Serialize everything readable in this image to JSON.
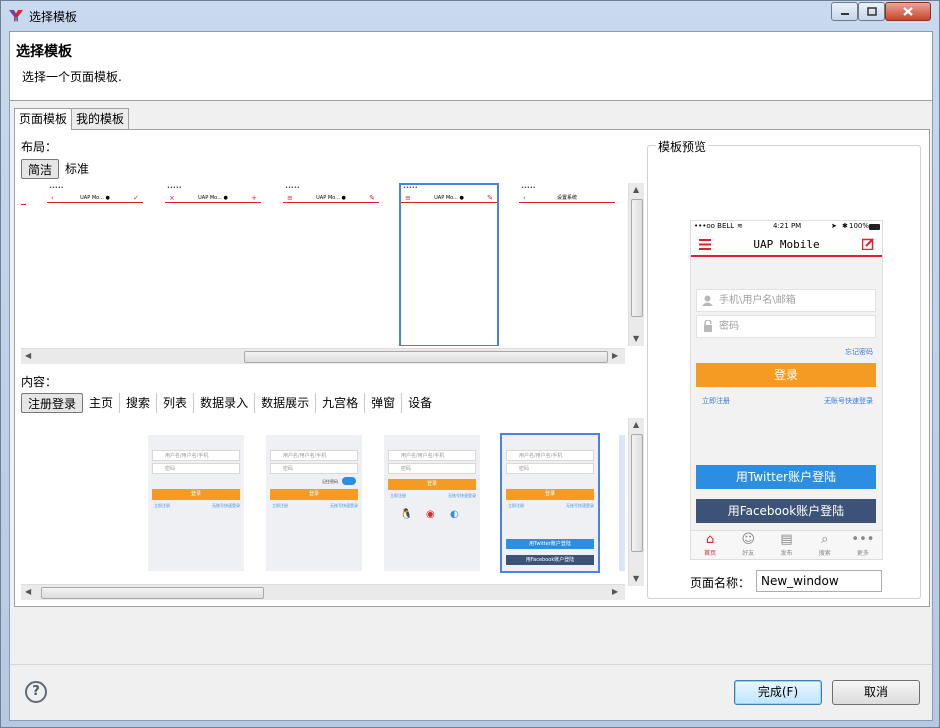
{
  "window": {
    "title": "选择模板"
  },
  "header": {
    "title": "选择模板",
    "description": "选择一个页面模板."
  },
  "tabs": [
    "页面模板",
    "我的模板"
  ],
  "layout": {
    "label": "布局：",
    "options": [
      "简洁",
      "标准"
    ],
    "thumbs": [
      {
        "title": "UAP Mo... ●"
      },
      {
        "title": "UAP Mo... ●"
      },
      {
        "title": "UAP Mo... ●"
      },
      {
        "title": "UAP Mo... ●"
      },
      {
        "title": "设置系统"
      }
    ]
  },
  "content": {
    "label": "内容：",
    "options": [
      "注册登录",
      "主页",
      "搜索",
      "列表",
      "数据录入",
      "数据展示",
      "九宫格",
      "弹窗",
      "设备"
    ],
    "cards": [
      {
        "field1": "用户名/用户名/手机",
        "field2": "密码",
        "button": "登录",
        "link_left": "立即注册",
        "link_right": "无账号快速登录"
      },
      {
        "field1": "用户名/用户名/手机",
        "field2": "密码",
        "button": "登录",
        "link_left": "立即注册",
        "link_right": "无账号快速登录",
        "toggle": "记住密码"
      },
      {
        "field1": "用户名/用户名/手机",
        "field2": "密码",
        "button": "登录",
        "link_left": "立即注册",
        "link_right": "无账号快速登录"
      },
      {
        "field1": "用户名/用户名/手机",
        "field2": "密码",
        "button": "登录",
        "link_left": "立即注册",
        "link_right": "无账号快速登录",
        "twitter": "用Twitter账户登陆",
        "facebook": "用Facebook账户登陆"
      }
    ]
  },
  "preview": {
    "label": "模板预览",
    "status_carrier": "•••oo BELL",
    "status_time": "4:21 PM",
    "status_battery": "100%",
    "nav_title": "UAP Mobile",
    "username_placeholder": "手机\\用户名\\邮箱",
    "password_placeholder": "密码",
    "forgot": "忘记密码",
    "login": "登录",
    "register": "立即注册",
    "quick_login": "无账号快速登录",
    "twitter": "用Twitter账户登陆",
    "facebook": "用Facebook账户登陆",
    "tabbar": [
      "首页",
      "好友",
      "发布",
      "搜索",
      "更多"
    ]
  },
  "page_name": {
    "label": "页面名称：",
    "value": "New_window"
  },
  "buttons": {
    "finish": "完成(F)",
    "cancel": "取消"
  },
  "colors": {
    "accent_red": "#e0202a",
    "login_orange": "#f59a23",
    "twitter_blue": "#2b8ee0",
    "facebook_navy": "#3d5277",
    "selection_blue": "#4a80e8"
  }
}
